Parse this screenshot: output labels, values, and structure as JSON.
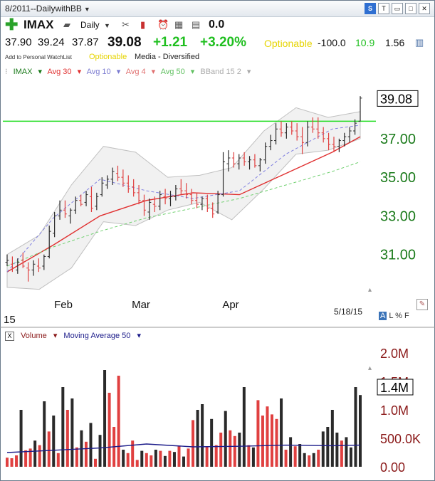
{
  "window": {
    "title": "8/2011--DailywithBB"
  },
  "titlebar_icons": [
    "S",
    "T",
    "restore",
    "maximize",
    "close"
  ],
  "toolbar": {
    "symbol": "IMAX",
    "period": "Daily",
    "change_value": "0.0"
  },
  "quote": {
    "open": "37.90",
    "high": "39.24",
    "low": "37.87",
    "last": "39.08",
    "change": "+1.21",
    "change_pct": "+3.20%",
    "optionable": "Optionable",
    "v1": "-100.0",
    "v2": "10.9",
    "v3": "1.56"
  },
  "subrow": {
    "watchlist": "Add to Personal WatchList",
    "optionable": "Optionable",
    "industry": "Media - Diversified"
  },
  "legend": {
    "symbol": "IMAX",
    "avg30": "Avg 30",
    "avg10": "Avg 10",
    "avg4": "Avg 4",
    "avg50": "Avg 50",
    "bband": "BBand 15 2"
  },
  "price_label": "39.08",
  "date_label": "5/18/15",
  "left_label": "15",
  "alpf": {
    "a": "A",
    "rest": "L % F"
  },
  "volume_legend": {
    "close": "X",
    "volume": "Volume",
    "ma": "Moving Average 50"
  },
  "volume_label": "1.4M",
  "colors": {
    "up": "#2a2a2a",
    "down": "#e04040",
    "axis": "#1a7a1a",
    "axis_vol": "#8b1a1a",
    "ma30": "#e03030",
    "ma10": "#8080e0",
    "ma50": "#70d070",
    "resistance": "#22dd22",
    "ma50vol": "#1c1c8a"
  },
  "chart_data": [
    {
      "type": "line",
      "title": "IMAX",
      "x_ticks": [
        "Feb",
        "Mar",
        "Apr"
      ],
      "y_ticks": [
        "31.00",
        "33.00",
        "35.00",
        "37.00"
      ],
      "ylim": [
        29.0,
        40.2
      ],
      "resistance": 37.9,
      "last_price": 39.08,
      "series": [
        {
          "name": "Avg 30",
          "x": [
            0,
            10,
            20,
            30,
            40,
            50,
            60,
            70,
            76
          ],
          "values": [
            30.1,
            31.5,
            33.0,
            33.8,
            34.2,
            34.1,
            35.2,
            36.3,
            37.1
          ]
        },
        {
          "name": "Avg 10",
          "x": [
            0,
            10,
            20,
            30,
            40,
            50,
            60,
            70,
            76
          ],
          "values": [
            30.1,
            32.9,
            34.9,
            34.3,
            33.9,
            34.3,
            36.2,
            37.5,
            37.7
          ]
        },
        {
          "name": "Avg 50",
          "x": [
            0,
            10,
            20,
            30,
            40,
            50,
            60,
            70,
            76
          ],
          "values": [
            30.4,
            31.4,
            32.2,
            32.9,
            33.4,
            33.9,
            34.6,
            35.3,
            35.8
          ]
        }
      ],
      "bars": [
        {
          "o": 30.6,
          "h": 31.0,
          "l": 30.4,
          "c": 30.7
        },
        {
          "o": 30.5,
          "h": 30.9,
          "l": 30.1,
          "c": 30.3
        },
        {
          "o": 30.2,
          "h": 30.8,
          "l": 30.0,
          "c": 30.6
        },
        {
          "o": 30.7,
          "h": 31.1,
          "l": 30.3,
          "c": 30.4
        },
        {
          "o": 30.3,
          "h": 30.6,
          "l": 29.6,
          "c": 30.2
        },
        {
          "o": 30.2,
          "h": 30.7,
          "l": 29.9,
          "c": 30.5
        },
        {
          "o": 30.4,
          "h": 30.8,
          "l": 30.1,
          "c": 30.3
        },
        {
          "o": 30.4,
          "h": 31.0,
          "l": 30.2,
          "c": 30.9
        },
        {
          "o": 30.9,
          "h": 32.5,
          "l": 30.8,
          "c": 32.2
        },
        {
          "o": 32.1,
          "h": 33.2,
          "l": 31.9,
          "c": 33.0
        },
        {
          "o": 33.0,
          "h": 33.8,
          "l": 32.8,
          "c": 33.3
        },
        {
          "o": 33.3,
          "h": 33.8,
          "l": 32.9,
          "c": 33.1
        },
        {
          "o": 33.0,
          "h": 33.4,
          "l": 32.6,
          "c": 33.3
        },
        {
          "o": 33.3,
          "h": 34.0,
          "l": 33.1,
          "c": 33.8
        },
        {
          "o": 33.8,
          "h": 34.1,
          "l": 33.5,
          "c": 33.6
        },
        {
          "o": 33.7,
          "h": 34.3,
          "l": 33.5,
          "c": 34.1
        },
        {
          "o": 34.0,
          "h": 34.5,
          "l": 33.2,
          "c": 33.4
        },
        {
          "o": 33.5,
          "h": 34.2,
          "l": 33.3,
          "c": 34.0
        },
        {
          "o": 34.1,
          "h": 35.0,
          "l": 34.0,
          "c": 34.7
        },
        {
          "o": 34.6,
          "h": 35.1,
          "l": 34.4,
          "c": 34.9
        },
        {
          "o": 34.9,
          "h": 35.5,
          "l": 34.6,
          "c": 35.3
        },
        {
          "o": 35.2,
          "h": 35.6,
          "l": 34.8,
          "c": 35.0
        },
        {
          "o": 35.0,
          "h": 35.4,
          "l": 34.5,
          "c": 34.7
        },
        {
          "o": 34.7,
          "h": 35.1,
          "l": 34.2,
          "c": 34.4
        },
        {
          "o": 34.5,
          "h": 34.9,
          "l": 34.0,
          "c": 34.2
        },
        {
          "o": 34.2,
          "h": 34.6,
          "l": 33.6,
          "c": 33.8
        },
        {
          "o": 33.8,
          "h": 34.1,
          "l": 33.0,
          "c": 33.3
        },
        {
          "o": 33.2,
          "h": 33.9,
          "l": 32.8,
          "c": 33.7
        },
        {
          "o": 33.6,
          "h": 34.0,
          "l": 33.2,
          "c": 33.5
        },
        {
          "o": 33.5,
          "h": 34.3,
          "l": 33.3,
          "c": 34.1
        },
        {
          "o": 34.0,
          "h": 34.4,
          "l": 33.6,
          "c": 33.9
        },
        {
          "o": 33.9,
          "h": 34.3,
          "l": 33.5,
          "c": 34.0
        },
        {
          "o": 34.0,
          "h": 34.6,
          "l": 33.8,
          "c": 34.4
        },
        {
          "o": 34.4,
          "h": 34.9,
          "l": 34.1,
          "c": 34.3
        },
        {
          "o": 34.3,
          "h": 34.7,
          "l": 33.9,
          "c": 34.1
        },
        {
          "o": 34.1,
          "h": 34.4,
          "l": 33.6,
          "c": 33.8
        },
        {
          "o": 33.8,
          "h": 34.2,
          "l": 33.4,
          "c": 33.6
        },
        {
          "o": 33.6,
          "h": 34.0,
          "l": 33.3,
          "c": 33.9
        },
        {
          "o": 33.9,
          "h": 34.1,
          "l": 33.2,
          "c": 33.4
        },
        {
          "o": 33.4,
          "h": 33.7,
          "l": 32.9,
          "c": 33.1
        },
        {
          "o": 33.2,
          "h": 34.3,
          "l": 33.1,
          "c": 34.1
        },
        {
          "o": 34.1,
          "h": 36.3,
          "l": 34.0,
          "c": 35.8
        },
        {
          "o": 35.7,
          "h": 36.4,
          "l": 35.3,
          "c": 36.0
        },
        {
          "o": 36.0,
          "h": 36.3,
          "l": 35.5,
          "c": 35.7
        },
        {
          "o": 35.7,
          "h": 36.2,
          "l": 35.4,
          "c": 36.0
        },
        {
          "o": 36.0,
          "h": 36.3,
          "l": 35.6,
          "c": 35.8
        },
        {
          "o": 35.8,
          "h": 36.1,
          "l": 35.4,
          "c": 35.9
        },
        {
          "o": 35.9,
          "h": 36.2,
          "l": 35.5,
          "c": 35.6
        },
        {
          "o": 35.6,
          "h": 36.0,
          "l": 35.3,
          "c": 35.9
        },
        {
          "o": 35.9,
          "h": 36.8,
          "l": 35.7,
          "c": 36.6
        },
        {
          "o": 36.6,
          "h": 37.2,
          "l": 36.4,
          "c": 36.9
        },
        {
          "o": 36.9,
          "h": 37.8,
          "l": 36.7,
          "c": 37.5
        },
        {
          "o": 37.5,
          "h": 37.9,
          "l": 37.1,
          "c": 37.3
        },
        {
          "o": 37.3,
          "h": 37.8,
          "l": 37.0,
          "c": 37.6
        },
        {
          "o": 37.6,
          "h": 37.9,
          "l": 37.2,
          "c": 37.4
        },
        {
          "o": 37.4,
          "h": 37.8,
          "l": 36.9,
          "c": 37.1
        },
        {
          "o": 37.1,
          "h": 37.6,
          "l": 36.2,
          "c": 36.8
        },
        {
          "o": 36.8,
          "h": 37.9,
          "l": 36.6,
          "c": 37.6
        },
        {
          "o": 37.6,
          "h": 38.1,
          "l": 37.3,
          "c": 37.5
        },
        {
          "o": 37.5,
          "h": 38.1,
          "l": 37.0,
          "c": 37.3
        },
        {
          "o": 37.3,
          "h": 37.6,
          "l": 36.8,
          "c": 37.0
        },
        {
          "o": 37.0,
          "h": 37.3,
          "l": 36.4,
          "c": 36.7
        },
        {
          "o": 36.7,
          "h": 37.1,
          "l": 36.3,
          "c": 36.6
        },
        {
          "o": 36.6,
          "h": 37.0,
          "l": 36.3,
          "c": 36.9
        },
        {
          "o": 36.9,
          "h": 37.3,
          "l": 36.6,
          "c": 37.1
        },
        {
          "o": 37.1,
          "h": 37.6,
          "l": 36.8,
          "c": 37.4
        },
        {
          "o": 37.4,
          "h": 38.0,
          "l": 37.2,
          "c": 37.8
        },
        {
          "o": 37.9,
          "h": 39.2,
          "l": 37.9,
          "c": 39.1
        }
      ],
      "bband_upper": [
        31.0,
        32.0,
        34.6,
        36.6,
        36.3,
        35.0,
        35.1,
        35.5,
        37.4,
        38.6,
        38.1,
        38.4
      ],
      "bband_lower": [
        29.3,
        29.2,
        30.3,
        32.7,
        32.5,
        33.3,
        33.7,
        32.8,
        34.4,
        36.2,
        36.4,
        37.0
      ]
    },
    {
      "type": "bar",
      "title": "Volume",
      "y_ticks": [
        "0.00",
        "500.0K",
        "1.0M",
        "1.5M",
        "2.0M"
      ],
      "ylim": [
        0,
        2200000
      ],
      "ma_name": "Moving Average 50",
      "values": [
        160000,
        150000,
        200000,
        1000000,
        290000,
        320000,
        460000,
        380000,
        1150000,
        620000,
        900000,
        240000,
        1400000,
        1000000,
        1200000,
        340000,
        640000,
        440000,
        770000,
        140000,
        560000,
        1700000,
        1300000,
        700000,
        1600000,
        300000,
        240000,
        460000,
        120000,
        280000,
        240000,
        200000,
        300000,
        280000,
        190000,
        280000,
        260000,
        360000,
        180000,
        320000,
        820000,
        1000000,
        1100000,
        360000,
        840000,
        380000,
        600000,
        980000,
        640000,
        540000,
        600000,
        1400000,
        380000,
        340000,
        1170000,
        900000,
        1060000,
        920000,
        840000,
        1200000,
        300000,
        520000,
        360000,
        400000,
        240000,
        200000,
        240000,
        300000,
        620000,
        700000,
        1000000,
        600000,
        460000,
        520000,
        340000,
        1400000,
        1260000
      ],
      "up": [
        0,
        0,
        0,
        1,
        0,
        0,
        1,
        0,
        1,
        0,
        1,
        0,
        1,
        0,
        1,
        0,
        1,
        0,
        1,
        0,
        1,
        1,
        0,
        0,
        0,
        1,
        0,
        0,
        0,
        1,
        0,
        0,
        1,
        0,
        1,
        0,
        1,
        0,
        1,
        0,
        0,
        1,
        1,
        0,
        1,
        0,
        0,
        1,
        0,
        0,
        1,
        1,
        0,
        1,
        0,
        0,
        0,
        0,
        0,
        1,
        0,
        1,
        0,
        1,
        1,
        0,
        1,
        0,
        1,
        1,
        1,
        1,
        0,
        1,
        1,
        1,
        1
      ],
      "ma_x": [
        0,
        10,
        20,
        30,
        40,
        50,
        60,
        70,
        76
      ],
      "ma_values": [
        250000,
        290000,
        330000,
        400000,
        350000,
        360000,
        380000,
        370000,
        380000
      ]
    }
  ]
}
